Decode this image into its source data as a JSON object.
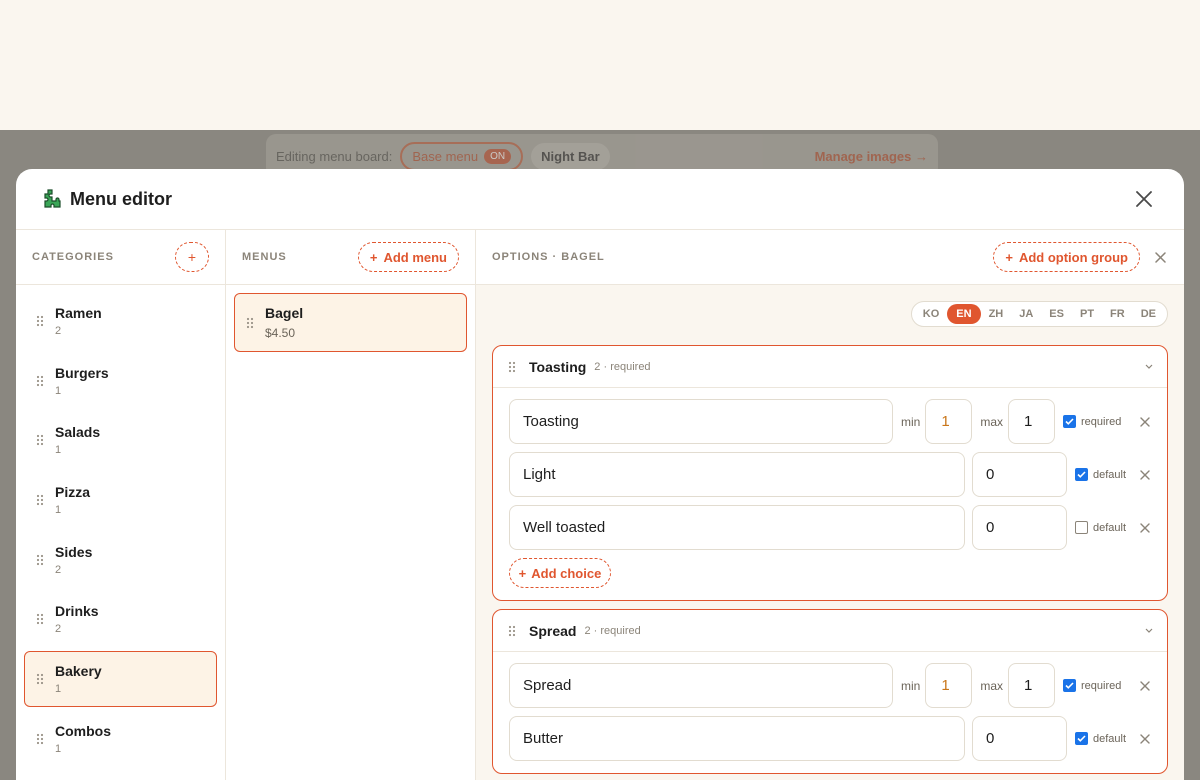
{
  "background": {
    "editing_label": "Editing menu board:",
    "base_menu_label": "Base menu",
    "base_menu_badge": "ON",
    "night_bar_label": "Night Bar",
    "manage_label": "Manage images →"
  },
  "modal": {
    "title": "Menu editor",
    "logo_icon": "puzzle-icon",
    "close_icon": "close-icon"
  },
  "categories": {
    "header": "CATEGORIES",
    "add_icon": "+",
    "items": [
      {
        "name": "Ramen",
        "count": "2"
      },
      {
        "name": "Burgers",
        "count": "1"
      },
      {
        "name": "Salads",
        "count": "1"
      },
      {
        "name": "Pizza",
        "count": "1"
      },
      {
        "name": "Sides",
        "count": "2"
      },
      {
        "name": "Drinks",
        "count": "2"
      },
      {
        "name": "Bakery",
        "count": "1"
      },
      {
        "name": "Combos",
        "count": "1"
      }
    ],
    "active_index": 6
  },
  "menus": {
    "header": "MENUS",
    "add_label": "Add menu",
    "items": [
      {
        "name": "Bagel",
        "price": "$4.50"
      }
    ]
  },
  "options": {
    "header": "OPTIONS · BAGEL",
    "add_label": "Add option group",
    "languages": [
      "KO",
      "EN",
      "ZH",
      "JA",
      "ES",
      "PT",
      "FR",
      "DE"
    ],
    "active_language": "EN",
    "groups": [
      {
        "name": "Toasting",
        "meta": "2 · required",
        "field_value": "Toasting",
        "min_label": "min",
        "min_value": "1",
        "max_label": "max",
        "max_value": "1",
        "required_label": "required",
        "required_checked": true,
        "choices": [
          {
            "name": "Light",
            "price": "0",
            "default_label": "default",
            "default_checked": true
          },
          {
            "name": "Well toasted",
            "price": "0",
            "default_label": "default",
            "default_checked": false
          }
        ],
        "add_choice_label": "Add choice"
      },
      {
        "name": "Spread",
        "meta": "2 · required",
        "field_value": "Spread",
        "min_label": "min",
        "min_value": "1",
        "max_label": "max",
        "max_value": "1",
        "required_label": "required",
        "required_checked": true,
        "choices": [
          {
            "name": "Butter",
            "price": "0",
            "default_label": "default",
            "default_checked": true
          }
        ]
      }
    ]
  },
  "colors": {
    "accent": "#e0562f",
    "active_bg": "#fdf3e6",
    "checkbox": "#1a73e8"
  }
}
